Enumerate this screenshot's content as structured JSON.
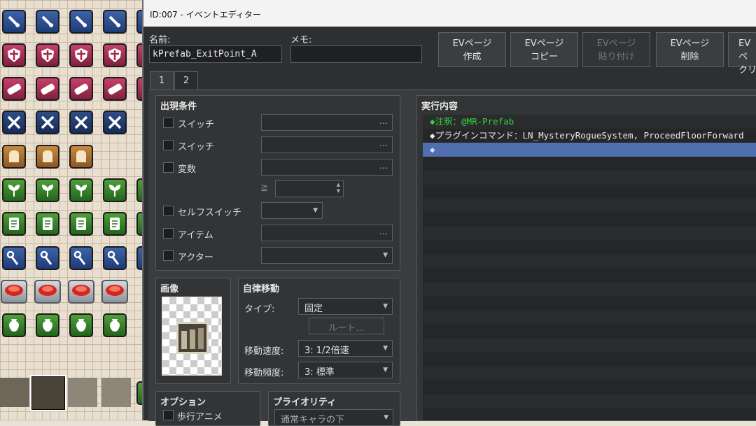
{
  "window": {
    "title": "ID:007 - イベントエディター"
  },
  "header": {
    "name_label": "名前:",
    "name_value": "kPrefab_ExitPoint_A",
    "memo_label": "メモ:",
    "memo_value": ""
  },
  "ev_buttons": [
    {
      "line1": "EVページ",
      "line2": "作成",
      "enabled": true
    },
    {
      "line1": "EVページ",
      "line2": "コピー",
      "enabled": true
    },
    {
      "line1": "EVページ",
      "line2": "貼り付け",
      "enabled": false
    },
    {
      "line1": "EVページ",
      "line2": "削除",
      "enabled": true
    },
    {
      "line1": "EVペ",
      "line2": "クリ",
      "enabled": true
    }
  ],
  "tabs": [
    {
      "label": "1",
      "active": true
    },
    {
      "label": "2",
      "active": false
    }
  ],
  "conditions": {
    "title": "出現条件",
    "switch1": "スイッチ",
    "switch2": "スイッチ",
    "variable": "変数",
    "gte": "≧",
    "self_switch": "セルフスイッチ",
    "item": "アイテム",
    "actor": "アクター",
    "dots": "…"
  },
  "image": {
    "title": "画像"
  },
  "autonomous": {
    "title": "自律移動",
    "type_label": "タイプ:",
    "type_value": "固定",
    "route_button": "ルート...",
    "speed_label": "移動速度:",
    "speed_value": "3: 1/2倍速",
    "freq_label": "移動頻度:",
    "freq_value": "3: 標準"
  },
  "options": {
    "title": "オプション",
    "walk_anim": "歩行アニメ"
  },
  "priority": {
    "title": "プライオリティ",
    "value": "通常キャラの下"
  },
  "exec": {
    "title": "実行内容",
    "commands": [
      {
        "text": "◆注釈：@MR-Prefab",
        "style": "green"
      },
      {
        "text": "◆プラグインコマンド：LN_MysteryRogueSystem, ProceedFloorForward",
        "style": "white"
      },
      {
        "text": "◆",
        "style": "selected"
      }
    ]
  },
  "tile_icons": [
    "sword-icon",
    "shield-icon",
    "bracer-icon",
    "crossed-swords-icon",
    "bread-icon",
    "herb-icon",
    "scroll-icon",
    "staff-icon",
    "red-button-icon",
    "vase-icon"
  ]
}
